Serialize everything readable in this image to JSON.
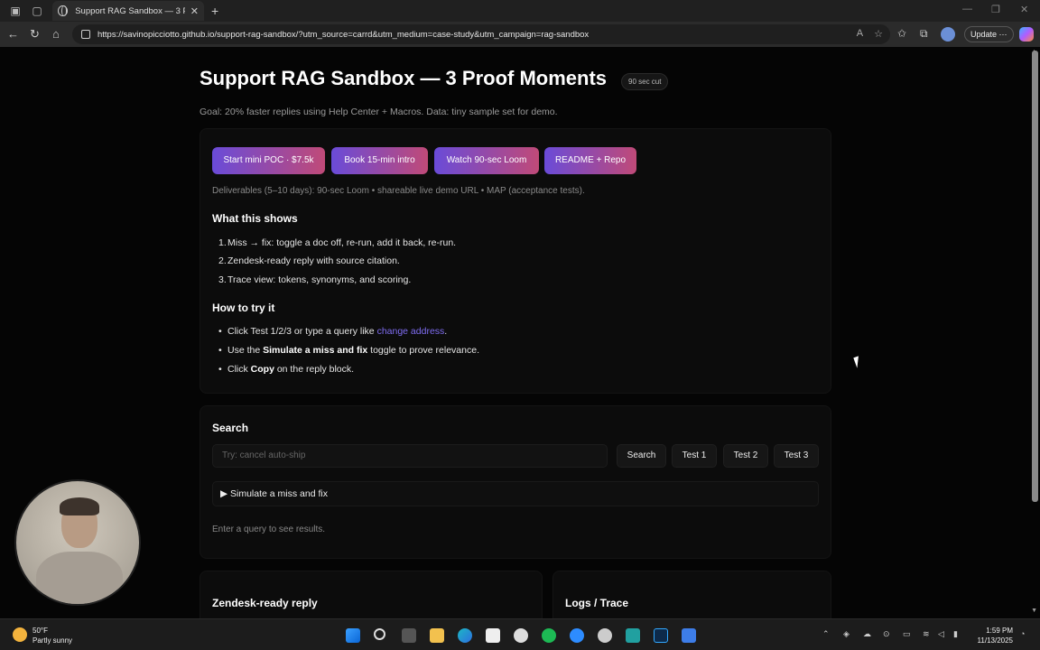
{
  "browser": {
    "tab_title": "Support RAG Sandbox — 3 Proof",
    "url": "https://savinopicciotto.github.io/support-rag-sandbox/?utm_source=carrd&utm_medium=case-study&utm_campaign=rag-sandbox",
    "update_label": "Update"
  },
  "page": {
    "title": "Support RAG Sandbox — 3 Proof Moments",
    "badge": "90 sec cut",
    "goal": "Goal: 20% faster replies using Help Center + Macros. Data: tiny sample set for demo.",
    "cta": {
      "start": "Start mini POC · $7.5k",
      "book": "Book 15-min intro",
      "watch": "Watch 90-sec Loom",
      "readme": "README + Repo"
    },
    "deliverables": "Deliverables (5–10 days): 90-sec Loom • shareable live demo URL • MAP (acceptance tests).",
    "what_heading": "What this shows",
    "what_items": [
      {
        "n": "1.",
        "text": "Miss → fix: toggle a doc off, re-run, add it back, re-run."
      },
      {
        "n": "2.",
        "text": "Zendesk-ready reply with source citation."
      },
      {
        "n": "3.",
        "text": "Trace view: tokens, synonyms, and scoring."
      }
    ],
    "how_heading": "How to try it",
    "how_items": {
      "i1_pre": "Click Test 1/2/3 or type a query like ",
      "i1_link": "change address",
      "i1_post": ".",
      "i2_pre": "Use the ",
      "i2_bold": "Simulate a miss and fix",
      "i2_post": " toggle to prove relevance.",
      "i3_pre": "Click ",
      "i3_bold": "Copy",
      "i3_post": " on the reply block."
    },
    "search": {
      "heading": "Search",
      "placeholder": "Try: cancel auto-ship",
      "search_btn": "Search",
      "test1": "Test 1",
      "test2": "Test 2",
      "test3": "Test 3",
      "simulate": "Simulate a miss and fix",
      "hint": "Enter a query to see results."
    },
    "reply_heading": "Zendesk-ready reply",
    "logs_heading": "Logs / Trace"
  },
  "taskbar": {
    "temp": "50°F",
    "weather": "Partly sunny",
    "time": "1:59 PM",
    "date": "11/13/2025"
  },
  "colors": {
    "cta_start": "#6a4bd8",
    "cta_end": "#c04a78",
    "link": "#7f6df2"
  }
}
